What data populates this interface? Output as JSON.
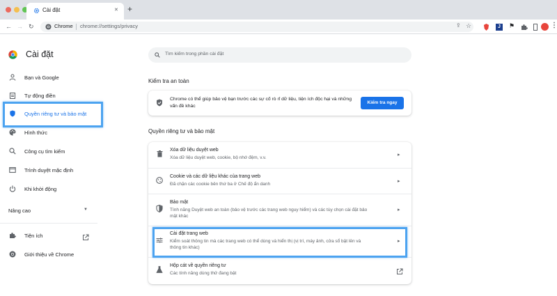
{
  "browser": {
    "tab_title": "Cài đặt",
    "tab_close": "✕",
    "new_tab": "+",
    "omnibox_site": "Chrome",
    "omnibox_url": "chrome://settings/privacy",
    "kebab": "⋮"
  },
  "app": {
    "title": "Cài đặt",
    "search_placeholder": "Tìm kiếm trong phần cài đặt"
  },
  "sidebar": {
    "items": [
      {
        "label": "Bạn và Google",
        "icon": "person-icon"
      },
      {
        "label": "Tự động điền",
        "icon": "clipboard-icon"
      },
      {
        "label": "Quyền riêng tư và bảo mật",
        "icon": "shield-icon"
      },
      {
        "label": "Hình thức",
        "icon": "palette-icon"
      },
      {
        "label": "Công cụ tìm kiếm",
        "icon": "search-icon"
      },
      {
        "label": "Trình duyệt mặc định",
        "icon": "browser-icon"
      },
      {
        "label": "Khi khởi động",
        "icon": "power-icon"
      }
    ],
    "advanced_label": "Nâng cao",
    "extensions_label": "Tiện ích",
    "about_label": "Giới thiệu về Chrome"
  },
  "safety_check": {
    "section_title": "Kiểm tra an toàn",
    "text_line1": "Chrome có thể giúp bảo vệ bạn trước các sự cố rò rỉ dữ liệu, tiện ích độc hại và những",
    "text_line2": "vấn đề khác",
    "button_label": "Kiểm tra ngay"
  },
  "privacy": {
    "section_title": "Quyền riêng tư và bảo mật",
    "rows": [
      {
        "title": "Xóa dữ liệu duyệt web",
        "desc1": "Xóa dữ liệu duyệt web, cookie, bộ nhớ đệm, v.v.",
        "desc2": ""
      },
      {
        "title": "Cookie và các dữ liệu khác của trang web",
        "desc1": "Đã chặn các cookie bên thứ ba ở Chế độ ẩn danh",
        "desc2": ""
      },
      {
        "title": "Bảo mật",
        "desc1": "Tính năng Duyệt web an toàn (bảo vệ trước các trang web nguy hiểm) và các tùy chọn cài đặt bảo",
        "desc2": "mật khác"
      },
      {
        "title": "Cài đặt trang web",
        "desc1": "Kiểm soát thông tin mà các trang web có thể dùng và hiển thị (vị trí, máy ảnh, cửa sổ bật lên và",
        "desc2": "thông tin khác)"
      },
      {
        "title": "Hộp cát về quyền riêng tư",
        "desc1": "Các tính năng dùng thử đang bật",
        "desc2": ""
      }
    ]
  },
  "colors": {
    "accent": "#1a73e8",
    "highlight_box": "#4ca3f0"
  }
}
